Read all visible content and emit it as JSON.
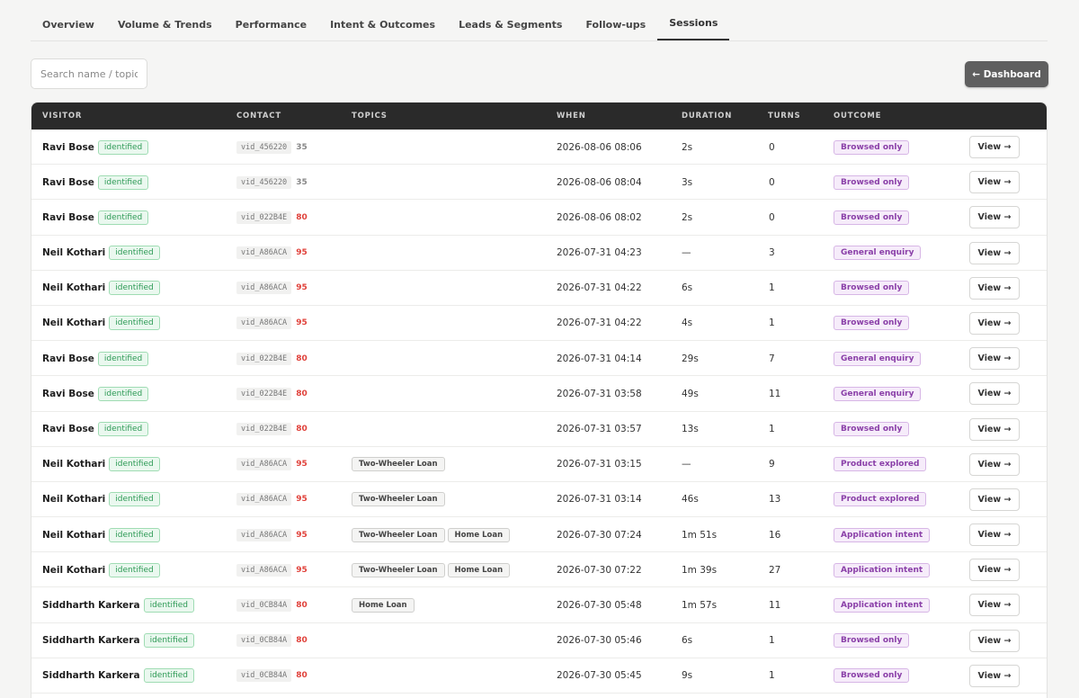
{
  "tabs": [
    {
      "label": "Overview",
      "active": false
    },
    {
      "label": "Volume & Trends",
      "active": false
    },
    {
      "label": "Performance",
      "active": false
    },
    {
      "label": "Intent & Outcomes",
      "active": false
    },
    {
      "label": "Leads & Segments",
      "active": false
    },
    {
      "label": "Follow-ups",
      "active": false
    },
    {
      "label": "Sessions",
      "active": true
    }
  ],
  "search": {
    "placeholder": "Search name / topic / "
  },
  "dashboard_button": {
    "label": "← Dashboard"
  },
  "table": {
    "columns": [
      "VISITOR",
      "CONTACT",
      "TOPICS",
      "WHEN",
      "DURATION",
      "TURNS",
      "OUTCOME"
    ],
    "view_label": "View →",
    "identified_label": "identified",
    "score_colors": {
      "35": "#888888",
      "80": "#e0413a",
      "95": "#e0413a"
    },
    "rows": [
      {
        "visitor": "Ravi Bose",
        "vid": "vid_456220",
        "score": "35",
        "topics": [],
        "when": "2026-08-06 08:06",
        "duration": "2s",
        "turns": "0",
        "outcome": "Browsed only"
      },
      {
        "visitor": "Ravi Bose",
        "vid": "vid_456220",
        "score": "35",
        "topics": [],
        "when": "2026-08-06 08:04",
        "duration": "3s",
        "turns": "0",
        "outcome": "Browsed only"
      },
      {
        "visitor": "Ravi Bose",
        "vid": "vid_022B4E",
        "score": "80",
        "topics": [],
        "when": "2026-08-06 08:02",
        "duration": "2s",
        "turns": "0",
        "outcome": "Browsed only"
      },
      {
        "visitor": "Neil Kothari",
        "vid": "vid_A86ACA",
        "score": "95",
        "topics": [],
        "when": "2026-07-31 04:23",
        "duration": "—",
        "turns": "3",
        "outcome": "General enquiry"
      },
      {
        "visitor": "Neil Kothari",
        "vid": "vid_A86ACA",
        "score": "95",
        "topics": [],
        "when": "2026-07-31 04:22",
        "duration": "6s",
        "turns": "1",
        "outcome": "Browsed only"
      },
      {
        "visitor": "Neil Kothari",
        "vid": "vid_A86ACA",
        "score": "95",
        "topics": [],
        "when": "2026-07-31 04:22",
        "duration": "4s",
        "turns": "1",
        "outcome": "Browsed only"
      },
      {
        "visitor": "Ravi Bose",
        "vid": "vid_022B4E",
        "score": "80",
        "topics": [],
        "when": "2026-07-31 04:14",
        "duration": "29s",
        "turns": "7",
        "outcome": "General enquiry"
      },
      {
        "visitor": "Ravi Bose",
        "vid": "vid_022B4E",
        "score": "80",
        "topics": [],
        "when": "2026-07-31 03:58",
        "duration": "49s",
        "turns": "11",
        "outcome": "General enquiry"
      },
      {
        "visitor": "Ravi Bose",
        "vid": "vid_022B4E",
        "score": "80",
        "topics": [],
        "when": "2026-07-31 03:57",
        "duration": "13s",
        "turns": "1",
        "outcome": "Browsed only"
      },
      {
        "visitor": "Neil Kothari",
        "vid": "vid_A86ACA",
        "score": "95",
        "topics": [
          "Two-Wheeler Loan"
        ],
        "when": "2026-07-31 03:15",
        "duration": "—",
        "turns": "9",
        "outcome": "Product explored"
      },
      {
        "visitor": "Neil Kothari",
        "vid": "vid_A86ACA",
        "score": "95",
        "topics": [
          "Two-Wheeler Loan"
        ],
        "when": "2026-07-31 03:14",
        "duration": "46s",
        "turns": "13",
        "outcome": "Product explored"
      },
      {
        "visitor": "Neil Kothari",
        "vid": "vid_A86ACA",
        "score": "95",
        "topics": [
          "Two-Wheeler Loan",
          "Home Loan"
        ],
        "when": "2026-07-30 07:24",
        "duration": "1m 51s",
        "turns": "16",
        "outcome": "Application intent"
      },
      {
        "visitor": "Neil Kothari",
        "vid": "vid_A86ACA",
        "score": "95",
        "topics": [
          "Two-Wheeler Loan",
          "Home Loan"
        ],
        "when": "2026-07-30 07:22",
        "duration": "1m 39s",
        "turns": "27",
        "outcome": "Application intent"
      },
      {
        "visitor": "Siddharth Karkera",
        "vid": "vid_0CB84A",
        "score": "80",
        "topics": [
          "Home Loan"
        ],
        "when": "2026-07-30 05:48",
        "duration": "1m 57s",
        "turns": "11",
        "outcome": "Application intent"
      },
      {
        "visitor": "Siddharth Karkera",
        "vid": "vid_0CB84A",
        "score": "80",
        "topics": [],
        "when": "2026-07-30 05:46",
        "duration": "6s",
        "turns": "1",
        "outcome": "Browsed only"
      },
      {
        "visitor": "Siddharth Karkera",
        "vid": "vid_0CB84A",
        "score": "80",
        "topics": [],
        "when": "2026-07-30 05:45",
        "duration": "9s",
        "turns": "1",
        "outcome": "Browsed only"
      }
    ]
  }
}
